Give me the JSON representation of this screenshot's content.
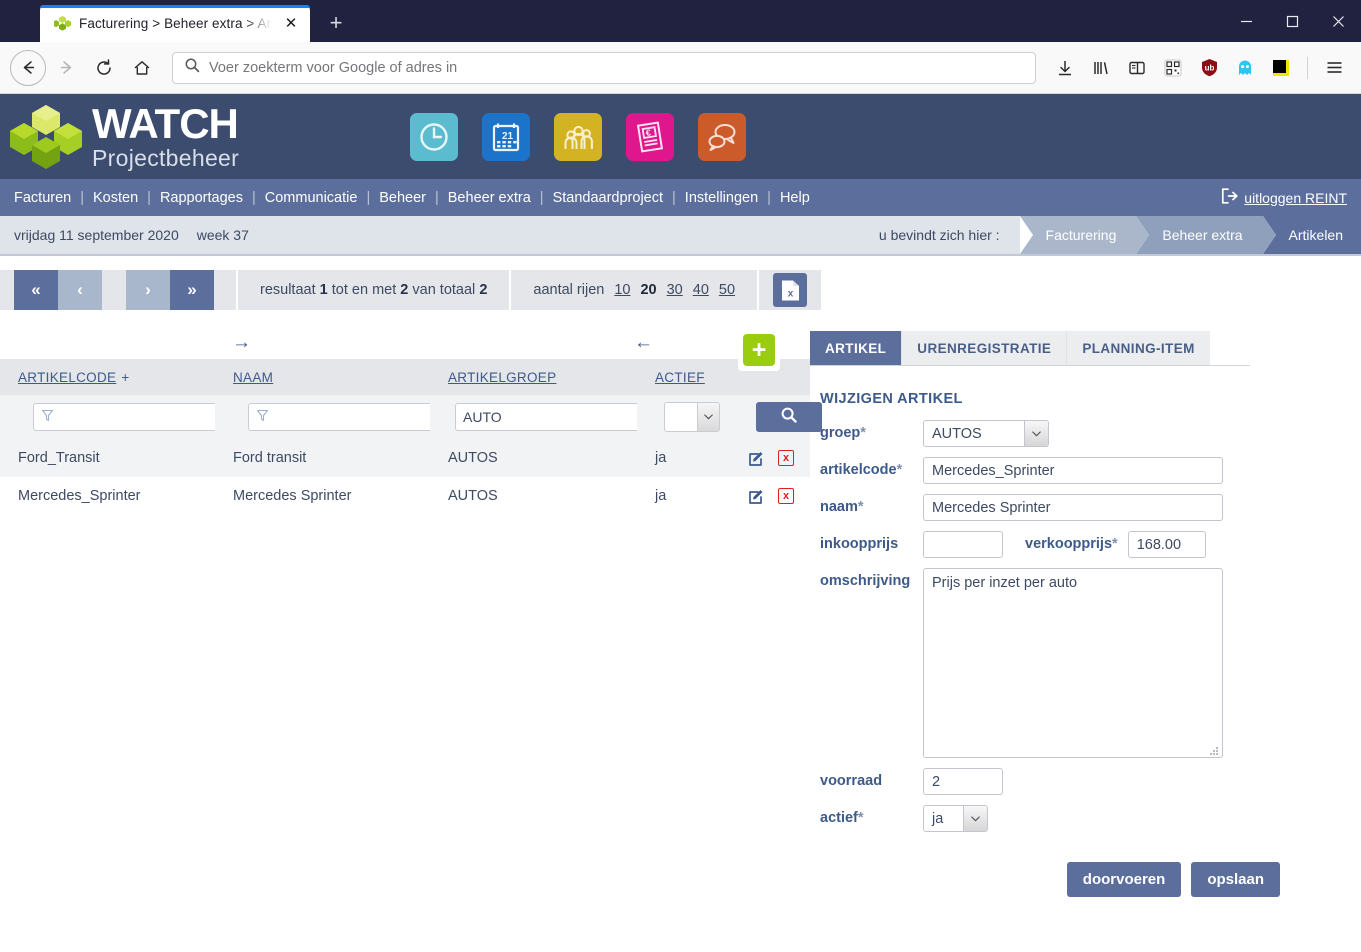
{
  "browser": {
    "tab_title": "Facturering > Beheer extra > Ar",
    "favicon_name": "watch-favicon",
    "new_tab_label": "+",
    "close_tab_label": "✕",
    "url_placeholder": "Voer zoekterm voor Google of adres in",
    "url_value": "",
    "window_controls": {
      "minimize": "—",
      "maximize": "□",
      "close": "✕"
    },
    "toolbar_icons": [
      "download-icon",
      "library-icon",
      "sidebar-icon",
      "qr-code-icon",
      "ublock-origin-icon",
      "ghostery-icon",
      "black-yellow-square-icon",
      "hamburger-menu-icon"
    ],
    "nav_icons": [
      "back-arrow-icon",
      "forward-arrow-icon",
      "reload-icon",
      "home-icon",
      "search-icon"
    ]
  },
  "app_header": {
    "logo_primary": "WATCH",
    "logo_secondary": "Projectbeheer",
    "app_icons": [
      {
        "name": "clock-icon",
        "color": "#5bbcd0"
      },
      {
        "name": "calendar-icon",
        "color": "#1b74c9",
        "day": "21"
      },
      {
        "name": "people-icon",
        "color": "#d4b323"
      },
      {
        "name": "invoice-euro-icon",
        "color": "#e0168c",
        "symbol": "€"
      },
      {
        "name": "chat-icon",
        "color": "#cc5b2b"
      }
    ]
  },
  "nav_menu": {
    "items": [
      "Facturen",
      "Kosten",
      "Rapportages",
      "Communicatie",
      "Beheer",
      "Beheer extra",
      "Standaardproject",
      "Instellingen",
      "Help"
    ],
    "separator": "|",
    "logout_label": "uitloggen REINT",
    "logout_icon": "logout-icon"
  },
  "status_bar": {
    "date": "vrijdag 11 september 2020",
    "week": "week 37",
    "here_label": "u bevindt zich hier :",
    "breadcrumbs": [
      "Facturering",
      "Beheer extra",
      "Artikelen"
    ]
  },
  "toolbar": {
    "first_label": "«",
    "prev_label": "‹",
    "next_label": "›",
    "last_label": "»",
    "result_prefix": "resultaat",
    "result_from": "1",
    "result_mid": "tot en met",
    "result_to": "2",
    "result_suffix": "van totaal",
    "result_total": "2",
    "rows_label": "aantal rijen",
    "rows_options": [
      "10",
      "20",
      "30",
      "40",
      "50"
    ],
    "rows_active": "20",
    "export_icon": "excel-export-icon",
    "export_letter": "x"
  },
  "table": {
    "arrow_right_icon": "→",
    "arrow_left_icon": "←",
    "add_button_label": "+",
    "headers": [
      {
        "label": "ARTIKELCODE",
        "sort_marker": "+"
      },
      {
        "label": "NAAM",
        "sort_marker": ""
      },
      {
        "label": "ARTIKELGROEP",
        "sort_marker": ""
      },
      {
        "label": "ACTIEF",
        "sort_marker": ""
      }
    ],
    "filters": {
      "artikelcode": "",
      "naam": "",
      "artikelgroep": "AUTO",
      "actief": "",
      "filter_icon": "funnel-icon",
      "search_icon": "search-icon"
    },
    "rows": [
      {
        "artikelcode": "Ford_Transit",
        "naam": "Ford transit",
        "artikelgroep": "AUTOS",
        "actief": "ja",
        "edit_icon": "edit-icon",
        "delete_icon": "delete-icon",
        "delete_glyph": "x"
      },
      {
        "artikelcode": "Mercedes_Sprinter",
        "naam": "Mercedes Sprinter",
        "artikelgroep": "AUTOS",
        "actief": "ja",
        "edit_icon": "edit-icon",
        "delete_icon": "delete-icon",
        "delete_glyph": "x"
      }
    ]
  },
  "panel": {
    "tabs": [
      {
        "label": "ARTIKEL",
        "active": true
      },
      {
        "label": "URENREGISTRATIE",
        "active": false
      },
      {
        "label": "PLANNING-ITEM",
        "active": false
      }
    ],
    "form_title": "WIJZIGEN ARTIKEL",
    "fields": {
      "groep_label": "groep",
      "groep_value": "AUTOS",
      "artikelcode_label": "artikelcode",
      "artikelcode_value": "Mercedes_Sprinter",
      "naam_label": "naam",
      "naam_value": "Mercedes Sprinter",
      "inkoopprijs_label": "inkoopprijs",
      "inkoopprijs_value": "",
      "verkoopprijs_label": "verkoopprijs",
      "verkoopprijs_value": "168.00",
      "omschrijving_label": "omschrijving",
      "omschrijving_value": "Prijs per inzet per auto",
      "voorraad_label": "voorraad",
      "voorraad_value": "2",
      "actief_label": "actief",
      "actief_value": "ja",
      "required_marker": "*"
    },
    "buttons": {
      "apply": "doorvoeren",
      "save": "opslaan"
    }
  },
  "colors": {
    "header_bg": "#3b4c6e",
    "nav_bg": "#5b6e9c",
    "crumb_bg": "#dfe3ea",
    "accent": "#5b6e9c",
    "add_green": "#9acd0d",
    "delete_red": "#e02020",
    "link_blue": "#3d5a8a"
  }
}
